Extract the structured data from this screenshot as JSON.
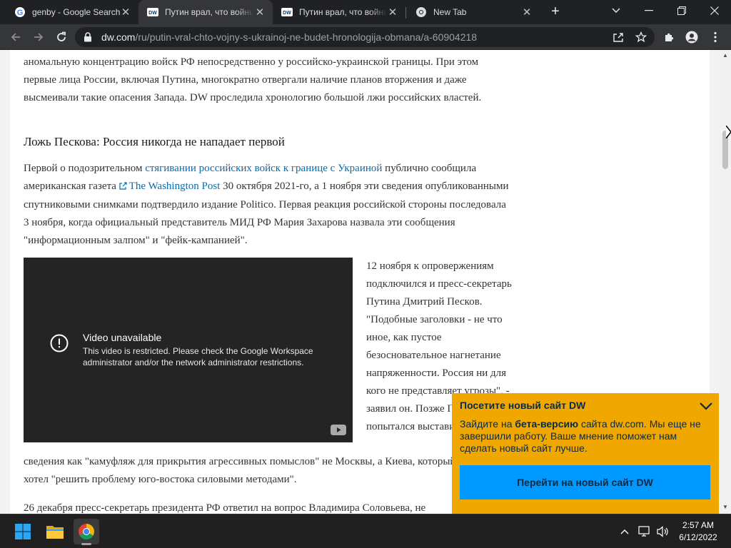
{
  "browser": {
    "tabs": [
      {
        "title": "genby - Google Search",
        "icon": "google-g-icon",
        "active": false
      },
      {
        "title": "Путин врал, что войны с Украиной не будет",
        "icon": "dw-logo-icon",
        "active": true
      },
      {
        "title": "Путин врал, что войны с Украиной не будет",
        "icon": "dw-logo-icon",
        "active": false
      },
      {
        "title": "New Tab",
        "icon": "chrome-icon",
        "active": false
      }
    ],
    "new_tab_icon": "plus-icon",
    "url_host": "dw.com",
    "url_path": "/ru/putin-vral-chto-vojny-s-ukrainoj-ne-budet-hronologija-obmana/a-60904218"
  },
  "article": {
    "paragraph1": "аномальную концентрацию войск РФ непосредственно у российско-украинской границы. При этом первые лица России, включая Путина, многократно отвергали наличие планов вторжения и даже высмеивали такие опасения Запада. DW проследила хронологию большой лжи российских властей.",
    "heading": "Ложь Пескова: Россия никогда не нападает первой",
    "paragraph2": {
      "before": "Первой о подозрительном ",
      "link": "стягивании российских войск к границе с Украиной",
      "middle": " публично сообщила американская газета ",
      "ext_link": "The Washington Post",
      "after": " 30 октября 2021-го, а 1 ноября эти сведения опубликованными спутниковыми снимками подтвердило издание Politico. Первая реакция российской стороны последовала 3 ноября, когда официальный представитель МИД РФ Мария Захарова назвала эти сообщения \"информационным залпом\" и \"фейк-кампанией\"."
    },
    "video": {
      "title": "Video unavailable",
      "message": "This video is restricted. Please check the Google Workspace administrator and/or the network administrator restrictions."
    },
    "side_text": "12 ноября к опровержениям подключился и пресс-секретарь Путина Дмитрий Песков. \"Подобные заголовки - не что иное, как пустое безосновательное нагнетание напряженности. Россия ни для кого не представляет угрозы\", - заявил он. Позже Песков попытался выставить эти",
    "paragraph3": "сведения как \"камуфляж для прикрытия агрессивных помыслов\" не Москвы, а Киева, который якобы хотел \"решить проблему юго-востока силовыми методами\".",
    "paragraph4": "26 декабря пресс-секретарь президента РФ ответил на вопрос Владимира Соловьева, не"
  },
  "banner": {
    "title": "Посетите новый сайт DW",
    "text_before": "Зайдите на ",
    "text_bold": "бета-версию",
    "text_after": " сайта dw.com. Мы еще не завершили работу. Ваше мнение поможет нам сделать новый сайт лучше.",
    "button": "Перейти на новый сайт DW",
    "colors": {
      "background": "#f0a800",
      "button": "#0099ff"
    }
  },
  "taskbar": {
    "time": "2:57 AM",
    "date": "6/12/2022",
    "apps": [
      "windows-start-icon",
      "file-explorer-icon",
      "chrome-icon"
    ]
  }
}
